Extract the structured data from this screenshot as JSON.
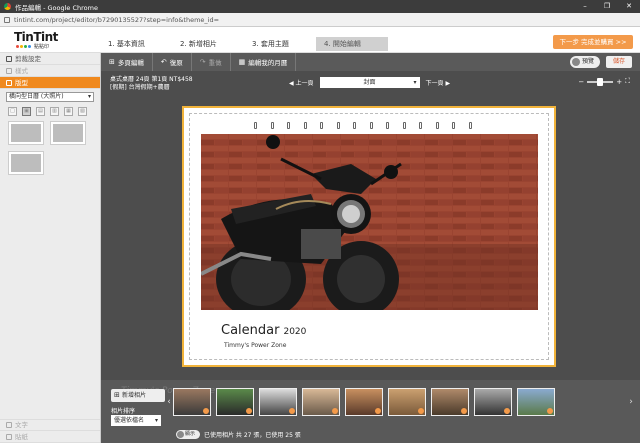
{
  "window": {
    "title": "作品編輯 - Google Chrome",
    "controls": [
      "–",
      "❐",
      "✕"
    ]
  },
  "address": {
    "url": "tintint.com/project/editor/b7290135527?step=info&theme_id="
  },
  "header": {
    "logo": "TinTint",
    "logo_sub": "點點印",
    "steps": [
      "1. 基本資訊",
      "2. 新增相片",
      "3. 套用主題",
      "4. 開始編輯"
    ],
    "active_step": 3,
    "next_button": "下一步 完成並購買 >>"
  },
  "sidebar": {
    "items": [
      {
        "label": "剪裁設定",
        "state": "normal"
      },
      {
        "label": "樣式",
        "state": "disabled"
      },
      {
        "label": "版型",
        "state": "active"
      }
    ],
    "layout_select": "橫向型日曆 (大照片)",
    "bottom_items": [
      {
        "label": "文字",
        "state": "disabled"
      },
      {
        "label": "貼紙",
        "state": "disabled"
      }
    ]
  },
  "toolbar": {
    "multi_page": "多頁編輯",
    "undo": "復原",
    "redo": "重做",
    "edit_month": "編輯我的月曆",
    "preview": "預覽",
    "save": "儲存"
  },
  "workspace": {
    "info_line1": "桌式桌曆 24頁 第1頁 NT$458",
    "info_line2": "[假期] 台灣假期+農曆",
    "prev": "上一頁",
    "page_select": "封面",
    "next": "下一頁",
    "zoom_minus": "−",
    "zoom_plus": "+",
    "fullscreen": "⛶"
  },
  "page": {
    "title": "Calendar",
    "year": "2020",
    "subtitle": "Timmy's Power Zone"
  },
  "filmstrip": {
    "add_photo": "新增相片",
    "sort_label": "相片排序",
    "sort_value": "優選依檔名",
    "toggle": "顯示",
    "status": "已使用相片 共 27 張，已使用 25 張",
    "watermark": "Timmy's Power Zone"
  },
  "colors": {
    "accent": "#f0891e",
    "page_border": "#f1b33a",
    "brick": "#8d3a28"
  }
}
